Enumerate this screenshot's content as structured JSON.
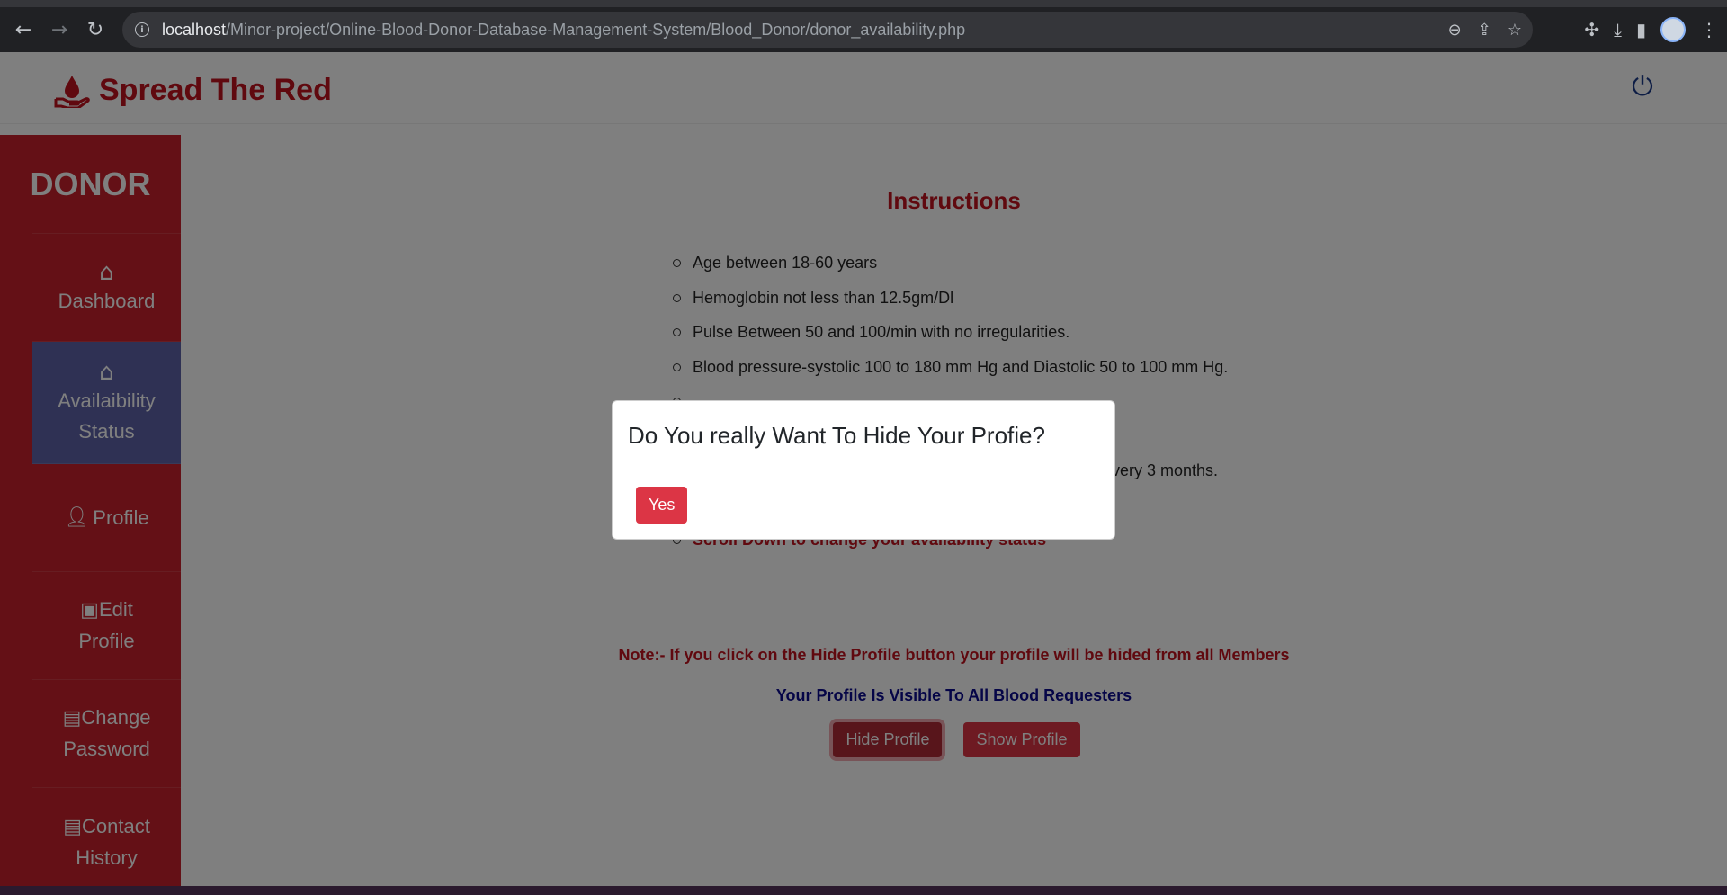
{
  "browser": {
    "url_host": "localhost",
    "url_path": "/Minor-project/Online-Blood-Donor-Database-Management-System/Blood_Donor/donor_availability.php"
  },
  "header": {
    "brand": "Spread The Red",
    "brand_color": "#c1121f"
  },
  "sidebar": {
    "title": "DONOR",
    "items": [
      {
        "label": "Dashboard",
        "icon": "home-icon"
      },
      {
        "label": "Availaibility Status",
        "icon": "home-icon",
        "active": true
      },
      {
        "label": "Profile",
        "icon": "user-icon"
      },
      {
        "label": "Edit Profile",
        "icon": "id-card-icon"
      },
      {
        "label": "Change Password",
        "icon": "document-icon"
      },
      {
        "label": "Contact History",
        "icon": "document-icon"
      }
    ]
  },
  "main": {
    "title": "Instructions",
    "instructions": [
      "Age between 18-60 years",
      "Hemoglobin not less than 12.5gm/Dl",
      "Pulse Between 50 and 100/min with no irregularities.",
      "Blood pressure-systolic 100 to 180 mm Hg and Diastolic 50 to 100 mm Hg.",
      "",
      "",
      "every 3 months.",
      "",
      "Scroll Down to change your availability status"
    ],
    "note": "Note:- If you click on the Hide Profile button your profile will be hided from all Members",
    "visibility_status": "Your Profile Is Visible To All Blood Requesters",
    "hide_button": "Hide Profile",
    "show_button": "Show Profile"
  },
  "modal": {
    "title": "Do You really Want To Hide Your Profie?",
    "yes_button": "Yes"
  },
  "colors": {
    "danger": "#dc3545",
    "sidebar": "#c8202c",
    "active": "#5e62a8",
    "status_blue": "#0b0b8f"
  }
}
